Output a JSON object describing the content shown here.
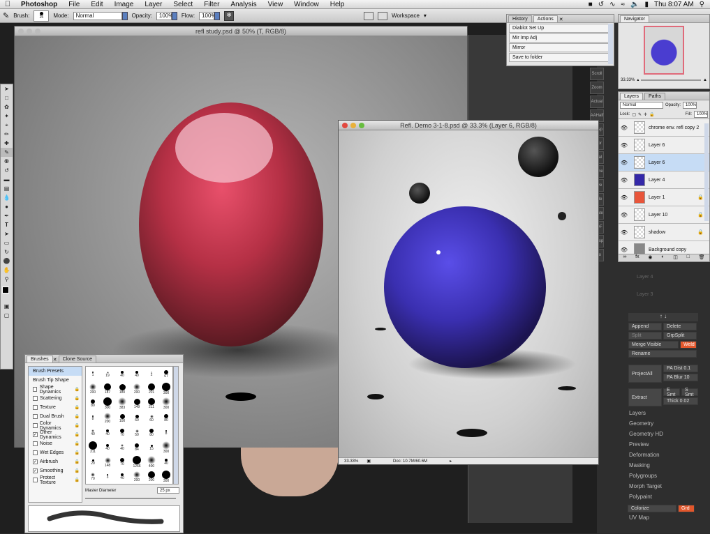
{
  "menubar": {
    "app": "Photoshop",
    "items": [
      "File",
      "Edit",
      "Image",
      "Layer",
      "Select",
      "Filter",
      "Analysis",
      "View",
      "Window",
      "Help"
    ],
    "clock": "Thu 8:07 AM"
  },
  "options": {
    "brush_label": "Brush:",
    "brush_size": "25",
    "mode_label": "Mode:",
    "mode_value": "Normal",
    "opacity_label": "Opacity:",
    "opacity_value": "100%",
    "flow_label": "Flow:",
    "flow_value": "100%",
    "workspace_label": "Workspace"
  },
  "doc1": {
    "title": "refl study.psd @ 50% (T, RGB/8)"
  },
  "doc2": {
    "title": "Refl. Demo 3-1-8.psd @ 33.3% (Layer 6, RGB/8)",
    "zoom": "33.33%",
    "doc_info": "Doc: 10.7M/60.6M"
  },
  "history": {
    "tabs": [
      "History",
      "Actions"
    ],
    "items": [
      "Diablot Set Up",
      "Mir Imp Adj",
      "Mirror",
      "Save to folder"
    ]
  },
  "navigator": {
    "tab": "Navigator",
    "zoom": "33.33%"
  },
  "layers": {
    "tabs": [
      "Layers",
      "Paths"
    ],
    "blend": "Normal",
    "opacity_label": "Opacity:",
    "opacity": "100%",
    "lock_label": "Lock:",
    "fill_label": "Fill:",
    "fill": "100%",
    "rows": [
      {
        "name": "chrome env. refl copy 2",
        "selected": false,
        "locked": false
      },
      {
        "name": "Layer 6",
        "selected": false,
        "locked": false
      },
      {
        "name": "Layer 6",
        "selected": true,
        "locked": false
      },
      {
        "name": "Layer 4",
        "selected": false,
        "locked": false
      },
      {
        "name": "Layer 1",
        "selected": false,
        "locked": true
      },
      {
        "name": "Layer 10",
        "selected": false,
        "locked": true
      },
      {
        "name": "shadow",
        "selected": false,
        "locked": true
      },
      {
        "name": "Background copy",
        "selected": false,
        "locked": false
      }
    ]
  },
  "brushes": {
    "tabs": [
      "Brushes",
      "Clone Source"
    ],
    "options": [
      {
        "label": "Brush Presets",
        "checked": null,
        "active": true
      },
      {
        "label": "Brush Tip Shape",
        "checked": null,
        "active": false
      },
      {
        "label": "Shape Dynamics",
        "checked": false,
        "active": false
      },
      {
        "label": "Scattering",
        "checked": false,
        "active": false
      },
      {
        "label": "Texture",
        "checked": false,
        "active": false
      },
      {
        "label": "Dual Brush",
        "checked": false,
        "active": false
      },
      {
        "label": "Color Dynamics",
        "checked": false,
        "active": false
      },
      {
        "label": "Other Dynamics",
        "checked": true,
        "active": false
      },
      {
        "label": "Noise",
        "checked": false,
        "active": false
      },
      {
        "label": "Wet Edges",
        "checked": false,
        "active": false
      },
      {
        "label": "Airbrush",
        "checked": true,
        "active": false
      },
      {
        "label": "Smoothing",
        "checked": true,
        "active": false
      },
      {
        "label": "Protect Texture",
        "checked": false,
        "active": false
      }
    ],
    "preset_rows": [
      [
        "1",
        "19",
        "40",
        "40",
        "2",
        "67"
      ],
      [
        "200",
        "187",
        "180",
        "200",
        "201",
        "300"
      ],
      [
        "80",
        "300",
        "383",
        "149",
        "211",
        "300"
      ],
      [
        "8",
        "200",
        "100",
        "60",
        "60",
        "80"
      ],
      [
        "40",
        "40",
        "70",
        "50",
        "80",
        "8"
      ],
      [
        "311",
        "40",
        "40",
        "84",
        "15",
        "300"
      ],
      [
        "20",
        "148",
        "70",
        "1266",
        "400",
        "40"
      ],
      [
        "70",
        "3",
        "40",
        "200",
        "200",
        "300"
      ]
    ],
    "master_diameter_label": "Master Diameter",
    "master_diameter_value": "25 px"
  },
  "zbrush": {
    "sub_buttons": [
      {
        "label": "Append"
      },
      {
        "label": "Delete"
      },
      {
        "label": "Split"
      },
      {
        "label": "GrpSplit"
      },
      {
        "label": "Merge Visible"
      },
      {
        "label": "Weld"
      },
      {
        "label": "Rename"
      }
    ],
    "project": "ProjectAll",
    "pa_dist": "PA Dist 0.1",
    "pa_blur": "PA Blur 10",
    "extract": "Extract",
    "e_smt": "E Smt",
    "s_smt": "S Smt",
    "thick": "Thick 0.02",
    "menus": [
      "Layers",
      "Geometry",
      "Geometry HD",
      "Preview",
      "Deformation",
      "Masking",
      "Polygroups",
      "Morph Target",
      "Polypaint",
      "UV Map"
    ],
    "colorize": "Colorize",
    "grd": "Grd",
    "faded_layers": [
      "Layer 5",
      "Layer 4",
      "Layer 3"
    ],
    "icons": [
      "Scroll",
      "Zoom",
      "Actual",
      "AAHalf",
      "Persp",
      "Floor",
      "Local",
      "Frame",
      "Move",
      "Scale",
      "Rotate",
      "PolyF",
      "Transp",
      "Solo"
    ]
  },
  "colors": {
    "accent": "#3d80df",
    "orange": "#e2572c",
    "selected_layer": "#c6dcf5"
  }
}
